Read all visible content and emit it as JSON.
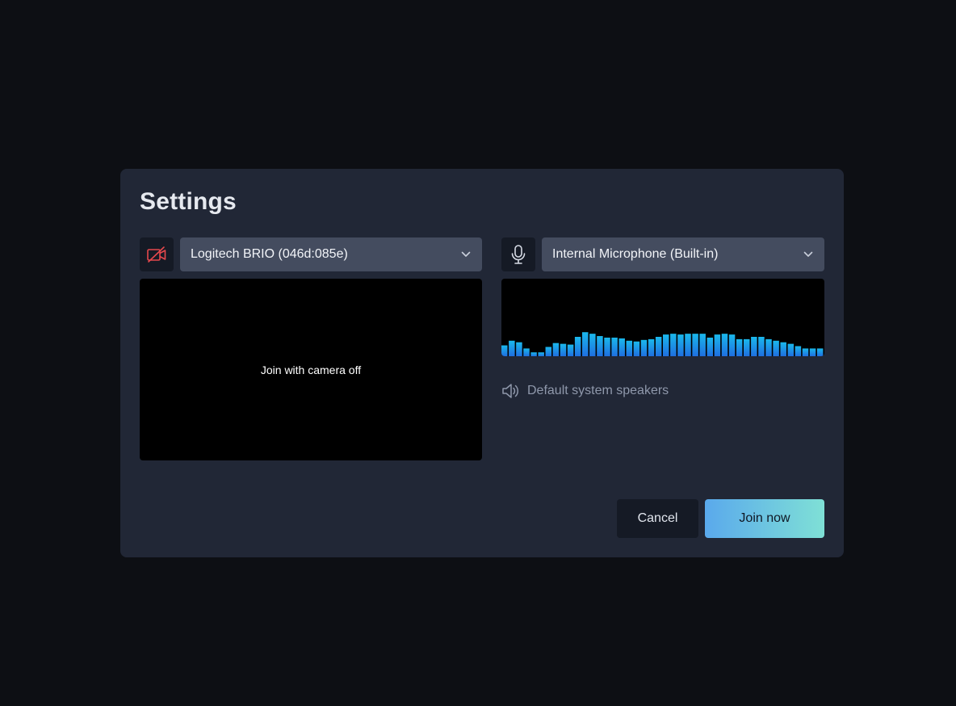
{
  "dialog": {
    "title": "Settings"
  },
  "camera": {
    "icon": "camera-off-icon",
    "device": "Logitech BRIO (046d:085e)",
    "preview_text": "Join with camera off"
  },
  "microphone": {
    "icon": "microphone-icon",
    "device": "Internal Microphone (Built-in)",
    "levels": [
      0.14,
      0.2,
      0.18,
      0.1,
      0.05,
      0.05,
      0.12,
      0.17,
      0.16,
      0.15,
      0.25,
      0.31,
      0.29,
      0.26,
      0.24,
      0.24,
      0.23,
      0.2,
      0.19,
      0.21,
      0.22,
      0.25,
      0.28,
      0.29,
      0.28,
      0.29,
      0.29,
      0.29,
      0.24,
      0.28,
      0.29,
      0.28,
      0.22,
      0.22,
      0.25,
      0.25,
      0.22,
      0.2,
      0.18,
      0.16,
      0.13,
      0.1,
      0.1,
      0.1
    ]
  },
  "speakers": {
    "icon": "speaker-icon",
    "label": "Default system speakers"
  },
  "actions": {
    "cancel_label": "Cancel",
    "join_label": "Join now"
  },
  "colors": {
    "background": "#0d0f14",
    "dialog": "#212736",
    "select": "#444c5f",
    "camera_off": "#e5484d",
    "meter_low": "#1f6fe0",
    "meter_high": "#1ab8ec"
  }
}
